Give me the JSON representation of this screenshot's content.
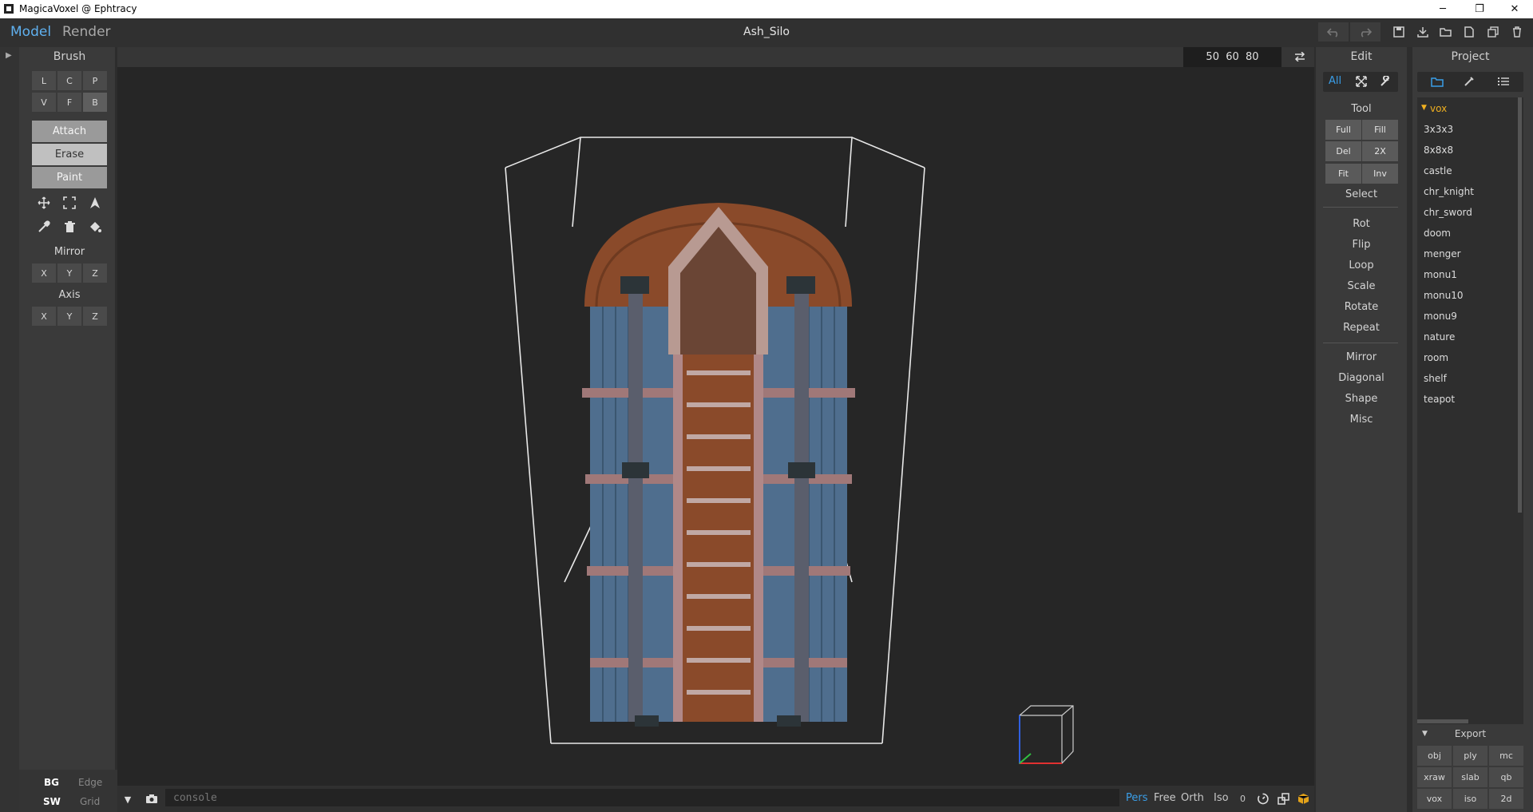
{
  "window": {
    "title": "MagicaVoxel @ Ephtracy",
    "minimize": "─",
    "restore": "❐",
    "close": "✕"
  },
  "header": {
    "tabs": [
      {
        "label": "Model",
        "active": true
      },
      {
        "label": "Render",
        "active": false
      }
    ],
    "document_title": "Ash_Silo",
    "toolbar_icons": [
      "undo-icon",
      "redo-icon",
      "save-icon",
      "save-as-icon",
      "open-icon",
      "new-icon",
      "copy-icon",
      "delete-icon"
    ]
  },
  "brush_panel": {
    "title": "Brush",
    "brush_types": [
      {
        "label": "L"
      },
      {
        "label": "C"
      },
      {
        "label": "P"
      },
      {
        "label": "V"
      },
      {
        "label": "F"
      },
      {
        "label": "B",
        "active": true
      }
    ],
    "modes": [
      {
        "label": "Attach"
      },
      {
        "label": "Erase",
        "active": true
      },
      {
        "label": "Paint"
      }
    ],
    "tools": [
      "move-icon",
      "select-box-icon",
      "pointer-icon",
      "color-picker-icon",
      "trash-icon",
      "paint-bucket-icon"
    ],
    "mirror": {
      "title": "Mirror",
      "axes": [
        "X",
        "Y",
        "Z"
      ]
    },
    "axis": {
      "title": "Axis",
      "axes": [
        "X",
        "Y",
        "Z"
      ]
    },
    "bottom": {
      "bg": "BG",
      "edge": "Edge",
      "sw": "SW",
      "grid": "Grid"
    }
  },
  "viewport": {
    "dimensions": "50  60  80",
    "console_placeholder": "console",
    "view_modes": [
      {
        "label": "Pers",
        "active": true
      },
      {
        "label": "Free"
      },
      {
        "label": "Orth"
      },
      {
        "label": "Iso"
      }
    ],
    "zero_label": "0",
    "colors": {
      "accent": "#3a9ee8",
      "roof": "#8a4a2a",
      "walls": "#4f6e8e",
      "frame": "#9b7474"
    }
  },
  "edit_panel": {
    "title": "Edit",
    "tabs": [
      "All",
      "expand-icon",
      "wrench-icon"
    ],
    "tool_title": "Tool",
    "tool_buttons": [
      "Full",
      "Fill",
      "Del",
      "2X",
      "Fit",
      "Inv"
    ],
    "select": "Select",
    "ops1": [
      "Rot",
      "Flip",
      "Loop",
      "Scale",
      "Rotate",
      "Repeat"
    ],
    "ops2": [
      "Mirror",
      "Diagonal",
      "Shape",
      "Misc"
    ]
  },
  "project_panel": {
    "title": "Project",
    "folder": "vox",
    "files": [
      "3x3x3",
      "8x8x8",
      "castle",
      "chr_knight",
      "chr_sword",
      "doom",
      "menger",
      "monu1",
      "monu10",
      "monu9",
      "nature",
      "room",
      "shelf",
      "teapot"
    ],
    "export": {
      "title": "Export",
      "formats": [
        "obj",
        "ply",
        "mc",
        "xraw",
        "slab",
        "qb",
        "vox",
        "iso",
        "2d"
      ]
    }
  }
}
